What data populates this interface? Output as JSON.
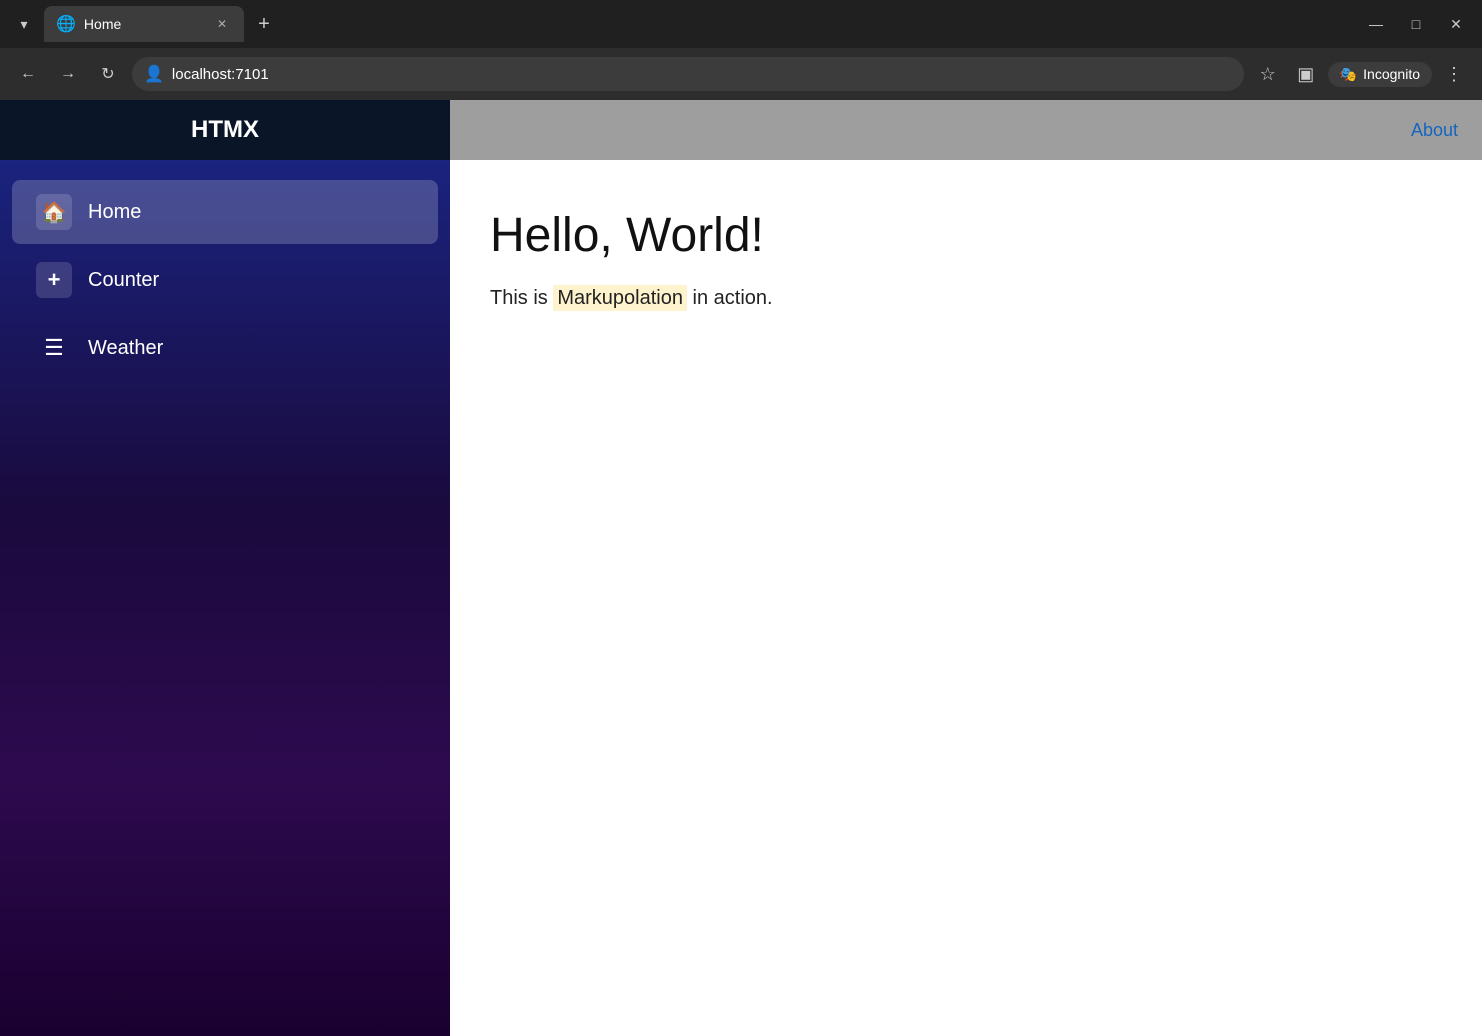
{
  "browser": {
    "tab": {
      "icon": "🌐",
      "title": "Home",
      "close_icon": "✕"
    },
    "new_tab_icon": "+",
    "window_controls": {
      "minimize": "—",
      "maximize": "□",
      "close": "✕"
    },
    "address_bar": {
      "back_icon": "←",
      "forward_icon": "→",
      "reload_icon": "↻",
      "address_icon": "👤",
      "url": "localhost:7101",
      "bookmark_icon": "☆",
      "extensions_icon": "▣",
      "incognito_icon": "🎭",
      "incognito_label": "Incognito",
      "more_icon": "⋮"
    }
  },
  "app": {
    "brand": "HTMX",
    "nav_about": "About",
    "sidebar": {
      "items": [
        {
          "id": "home",
          "label": "Home",
          "icon": "🏠",
          "active": true
        },
        {
          "id": "counter",
          "label": "Counter",
          "icon": "+",
          "active": false
        },
        {
          "id": "weather",
          "label": "Weather",
          "icon": "☰",
          "active": false
        }
      ]
    },
    "main": {
      "heading": "Hello, World!",
      "description_before": "This is ",
      "description_highlight": "Markupolation",
      "description_after": " in action."
    }
  }
}
